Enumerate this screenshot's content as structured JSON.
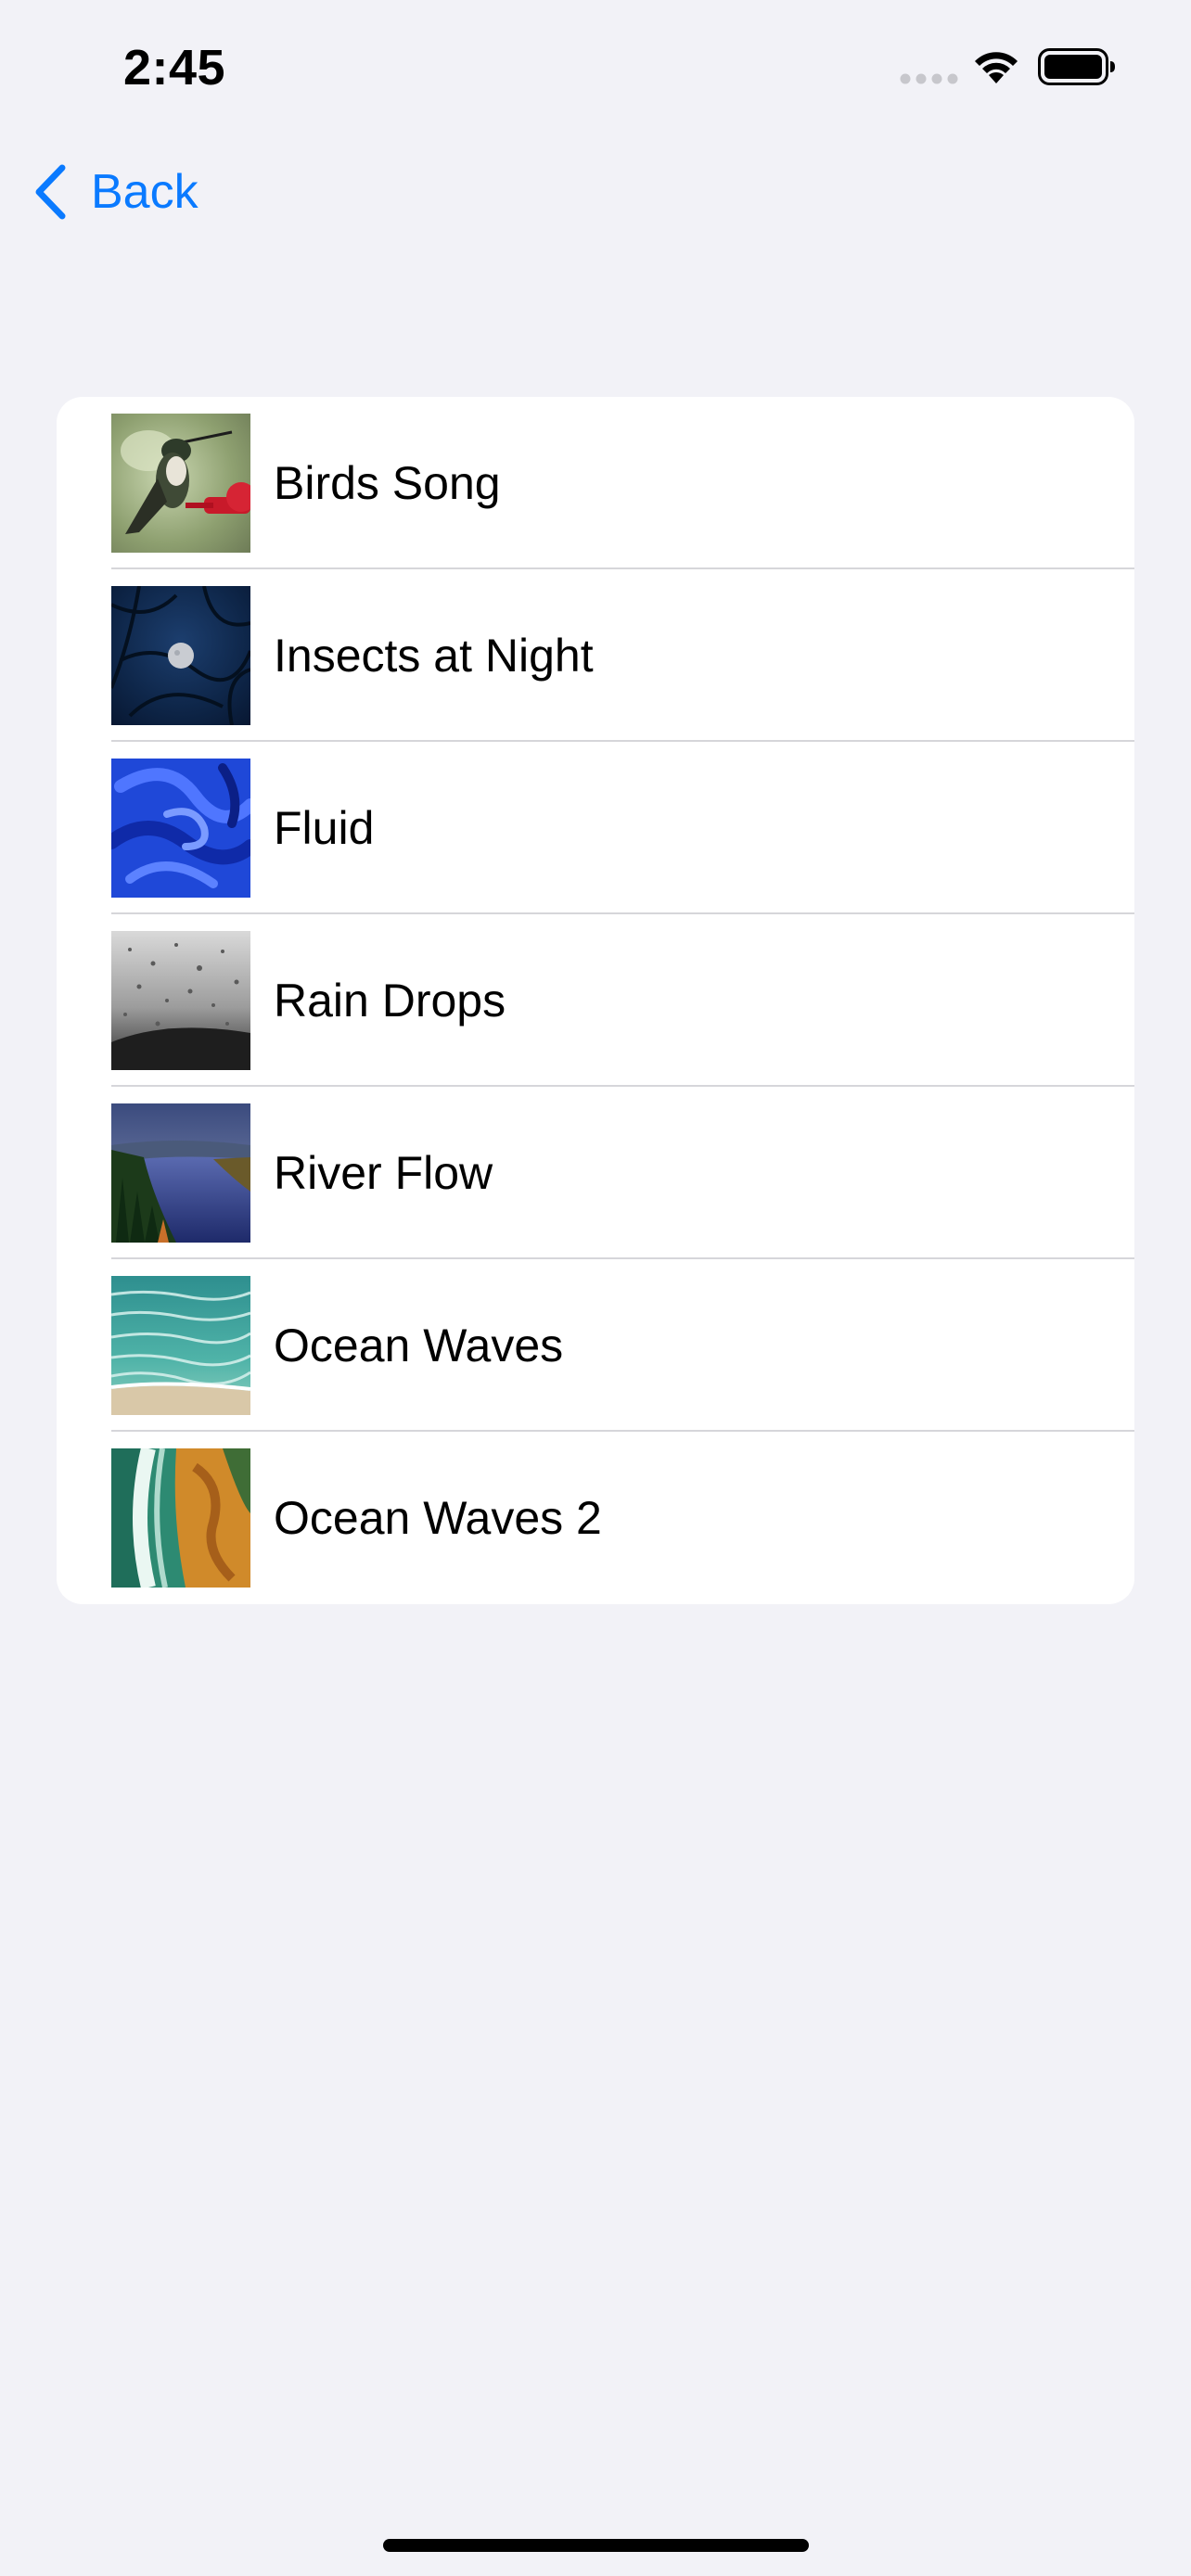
{
  "status_bar": {
    "time": "2:45"
  },
  "navigation": {
    "back_label": "Back",
    "accent_color": "#0a7aff"
  },
  "sounds": [
    {
      "label": "Birds Song",
      "thumbnail": "hummingbird-photo"
    },
    {
      "label": "Insects at Night",
      "thumbnail": "night-moon-photo"
    },
    {
      "label": "Fluid",
      "thumbnail": "blue-fluid-photo"
    },
    {
      "label": "Rain Drops",
      "thumbnail": "rain-window-photo"
    },
    {
      "label": "River Flow",
      "thumbnail": "river-forest-photo"
    },
    {
      "label": "Ocean Waves",
      "thumbnail": "ocean-waves-photo"
    },
    {
      "label": "Ocean Waves 2",
      "thumbnail": "aerial-beach-photo"
    }
  ]
}
